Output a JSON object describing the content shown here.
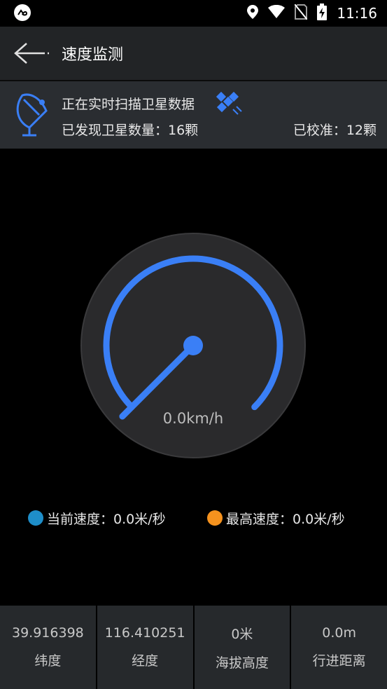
{
  "status_bar": {
    "time": "11:16",
    "icons": [
      "location-icon",
      "wifi-icon",
      "no-sim-icon",
      "battery-charging-icon"
    ]
  },
  "app_bar": {
    "title": "速度监测",
    "back_icon": "arrow-left-icon"
  },
  "satellite_info": {
    "scanning_text": "正在实时扫描卫星数据",
    "found_count": "已发现卫星数量：16颗",
    "calibrated_count": "已校准：12颗",
    "icons": [
      "satellite-dish-icon",
      "satellite-icon"
    ]
  },
  "gauge": {
    "value_text": "0.0km/h",
    "current_speed_kmh": 0.0,
    "needle_fraction": 0.0,
    "arc_color": "#3a7ff6",
    "face_color": "#2a2a2c"
  },
  "legend": {
    "current": {
      "text": "当前速度：0.0米/秒",
      "color": "#1e8ec9"
    },
    "max": {
      "text": "最高速度：0.0米/秒",
      "color": "#f5921e"
    }
  },
  "stats": [
    {
      "value": "39.916398",
      "label": "纬度"
    },
    {
      "value": "116.410251",
      "label": "经度"
    },
    {
      "value": "0米",
      "label": "海拔高度"
    },
    {
      "value": "0.0m",
      "label": "行进距离"
    }
  ],
  "colors": {
    "accent": "#3a7ff6",
    "app_bar": "#222426",
    "info_panel": "#2a2d31",
    "background": "#000000"
  }
}
